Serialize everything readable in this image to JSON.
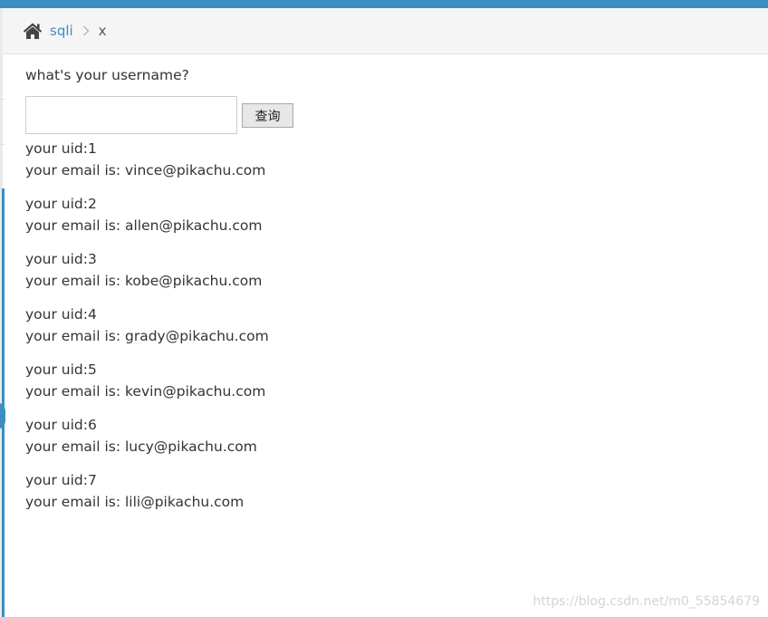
{
  "colors": {
    "accent": "#3b8ec2",
    "breadcrumb_bg": "#f5f5f5",
    "text": "#333333"
  },
  "breadcrumb": {
    "home_icon": "home-icon",
    "link": "sqli",
    "separator_icon": "chevron-right-icon",
    "current": "x"
  },
  "form": {
    "question": "what's your username?",
    "input_value": "",
    "input_placeholder": "",
    "button_label": "查询"
  },
  "results": [
    {
      "uid": "your uid:1",
      "email": "your email is: vince@pikachu.com"
    },
    {
      "uid": "your uid:2",
      "email": "your email is: allen@pikachu.com"
    },
    {
      "uid": "your uid:3",
      "email": "your email is: kobe@pikachu.com"
    },
    {
      "uid": "your uid:4",
      "email": "your email is: grady@pikachu.com"
    },
    {
      "uid": "your uid:5",
      "email": "your email is: kevin@pikachu.com"
    },
    {
      "uid": "your uid:6",
      "email": "your email is: lucy@pikachu.com"
    },
    {
      "uid": "your uid:7",
      "email": "your email is: lili@pikachu.com"
    }
  ],
  "watermark": "https://blog.csdn.net/m0_55854679"
}
